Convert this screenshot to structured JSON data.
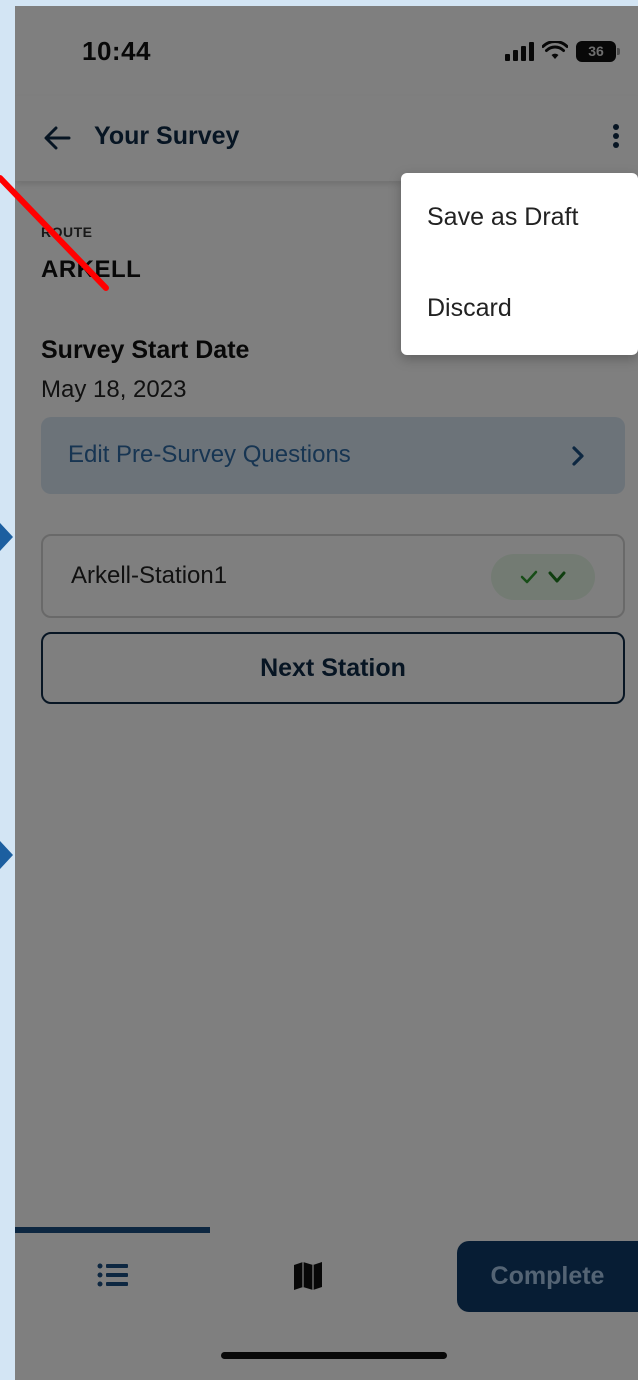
{
  "status_bar": {
    "time": "10:44",
    "battery": "36"
  },
  "header": {
    "title": "Your Survey"
  },
  "route": {
    "label": "ROUTE",
    "name": "ARKELL"
  },
  "survey_start": {
    "label": "Survey Start Date",
    "date": "May 18, 2023"
  },
  "pre_survey": {
    "label": "Edit Pre-Survey Questions"
  },
  "stations": [
    {
      "name": "Arkell-Station1",
      "status": "complete"
    }
  ],
  "next_station": {
    "label": "Next Station"
  },
  "bottom_bar": {
    "complete_label": "Complete"
  },
  "menu": {
    "items": [
      "Save as Draft",
      "Discard"
    ]
  },
  "colors": {
    "primary": "#0e2a47",
    "accent": "#1a4f82",
    "link": "#2f6aa4",
    "success": "#2e9a2e",
    "annotation": "#ff0000",
    "marker": "#1c5fa0"
  }
}
